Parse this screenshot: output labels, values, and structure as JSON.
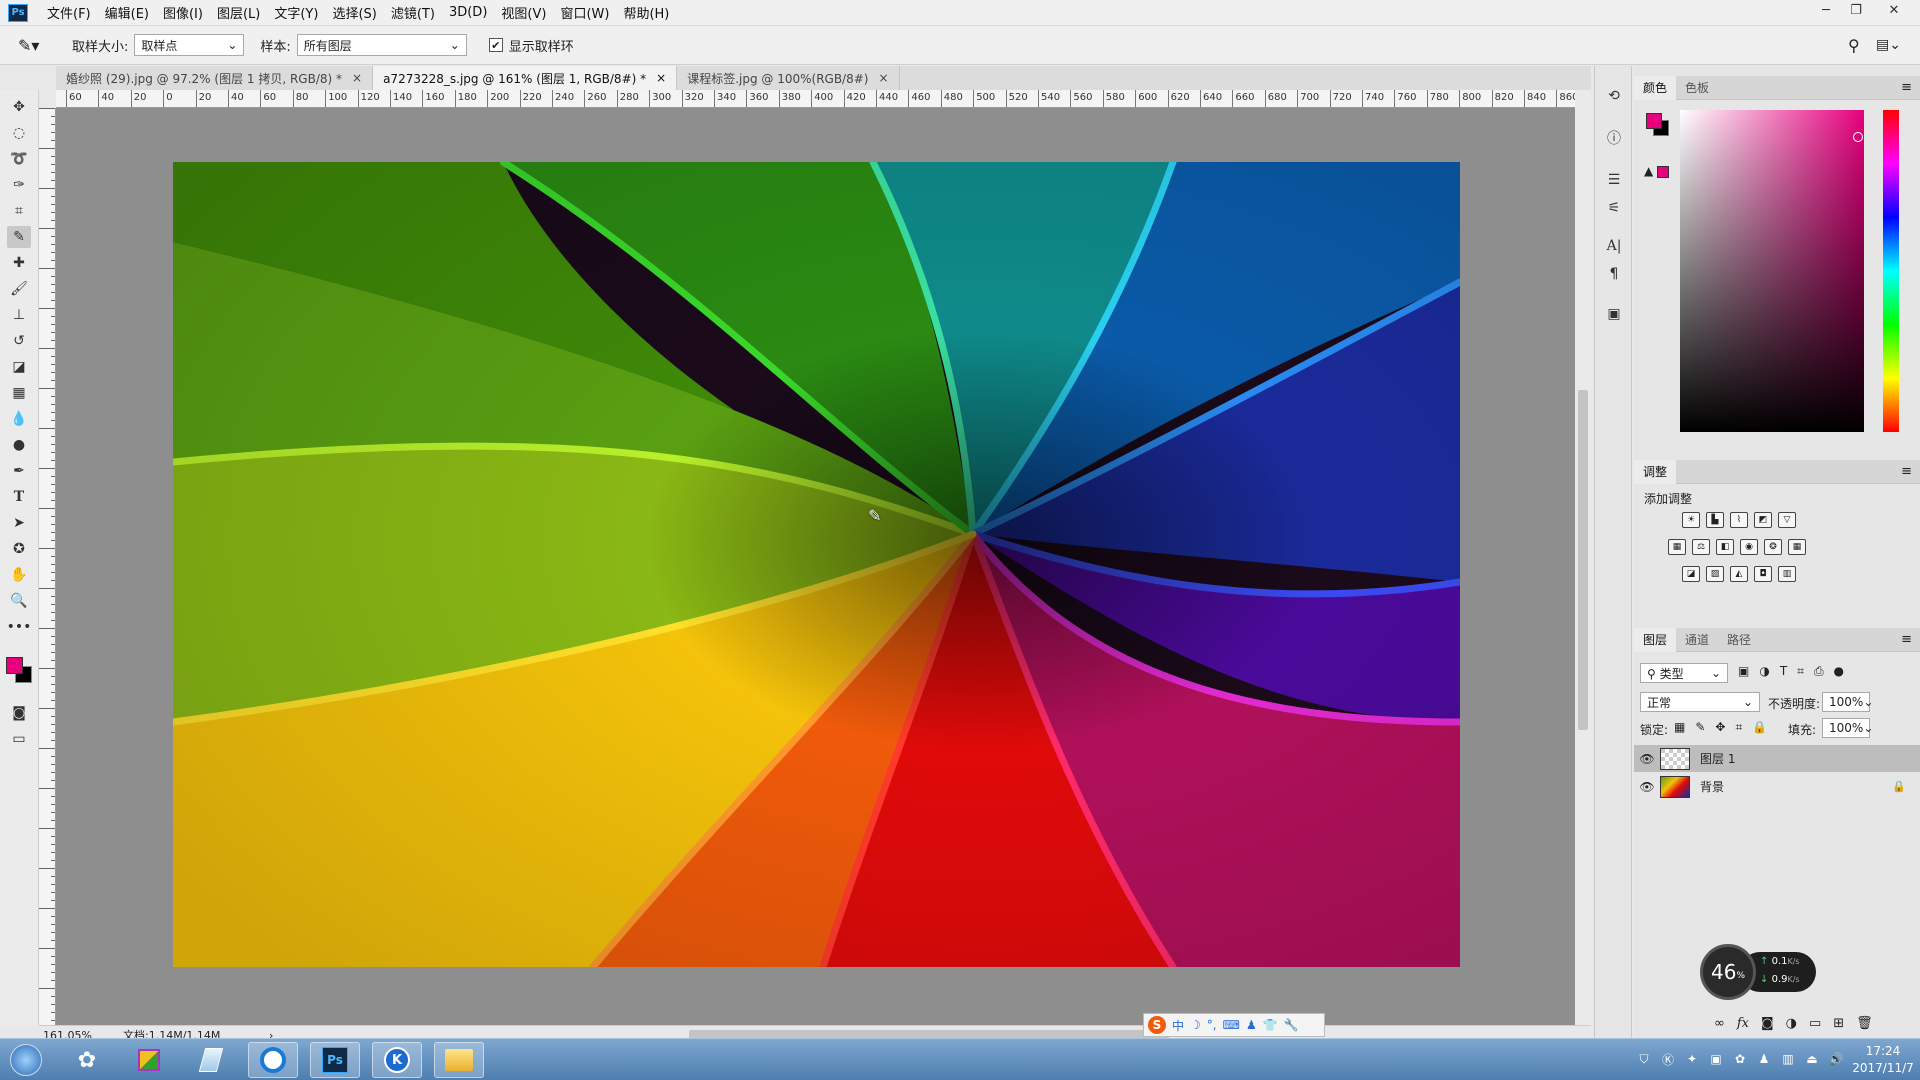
{
  "menubar": {
    "app_icon": "Ps",
    "items": [
      "文件(F)",
      "编辑(E)",
      "图像(I)",
      "图层(L)",
      "文字(Y)",
      "选择(S)",
      "滤镜(T)",
      "3D(D)",
      "视图(V)",
      "窗口(W)",
      "帮助(H)"
    ]
  },
  "options": {
    "sample_size_label": "取样大小:",
    "sample_size_value": "取样点",
    "sample_label": "样本:",
    "sample_value": "所有图层",
    "show_ring_label": "显示取样环",
    "show_ring_checked": true
  },
  "tabs": [
    {
      "label": "婚纱照 (29).jpg @ 97.2% (图层 1 拷贝, RGB/8) *",
      "close": "×"
    },
    {
      "label": "a7273228_s.jpg @ 161% (图层 1, RGB/8#) *",
      "close": "×"
    },
    {
      "label": "课程标签.jpg @ 100%(RGB/8#)",
      "close": "×"
    }
  ],
  "ruler_ticks": [
    "60",
    "40",
    "20",
    "0",
    "20",
    "40",
    "60",
    "80",
    "100",
    "120",
    "140",
    "160",
    "180",
    "200",
    "220",
    "240",
    "260",
    "280",
    "300",
    "320",
    "340",
    "360",
    "380",
    "400",
    "420",
    "440",
    "460",
    "480",
    "500",
    "520",
    "540",
    "560",
    "580",
    "600",
    "620",
    "640",
    "660",
    "680",
    "700",
    "720",
    "740",
    "760",
    "780",
    "800",
    "820",
    "840",
    "860"
  ],
  "status": {
    "zoom": "161.05%",
    "doc": "文档:1.14M/1.14M"
  },
  "colors": {
    "foreground": "#e6007e",
    "background": "#000000"
  },
  "color_panel": {
    "tabs": [
      "颜色",
      "色板"
    ]
  },
  "adjustments_panel": {
    "tab": "调整",
    "title": "添加调整"
  },
  "layers_panel": {
    "tabs": [
      "图层",
      "通道",
      "路径"
    ],
    "filter": "类型",
    "blend_mode": "正常",
    "opacity_label": "不透明度:",
    "opacity_value": "100%",
    "lock_label": "锁定:",
    "fill_label": "填充:",
    "fill_value": "100%",
    "layers": [
      {
        "name": "图层 1",
        "selected": true
      },
      {
        "name": "背景",
        "locked": true
      }
    ]
  },
  "net_widget": {
    "percent": "46",
    "unit": "%",
    "up": "0.1",
    "up_unit": "K/s",
    "down": "0.9",
    "down_unit": "K/s"
  },
  "ime_bar": {
    "items": [
      "S",
      "中",
      "☽",
      "°,",
      "⌨",
      "♟",
      "👕",
      "🔧"
    ]
  },
  "taskbar": {
    "time": "17:24",
    "date": "2017/11/7"
  }
}
